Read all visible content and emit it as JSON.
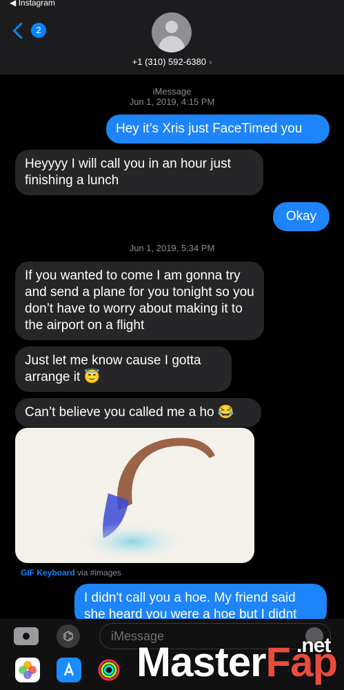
{
  "status": {
    "back_app": "◀ Instagram"
  },
  "header": {
    "unread_count": "2",
    "contact": "+1 (310) 592-6380",
    "contact_chevron": "›"
  },
  "thread": {
    "service": "iMessage",
    "timestamp1": "Jun 1, 2019, 4:15 PM",
    "timestamp2": "Jun 1, 2019, 5:34 PM",
    "messages": [
      {
        "dir": "out",
        "text": "Hey it’s Xris just FaceTimed you"
      },
      {
        "dir": "in",
        "text": "Heyyyy I will call you in an hour just finishing a lunch"
      },
      {
        "dir": "out",
        "text": "Okay"
      },
      {
        "dir": "in",
        "text": "If you wanted to come I am gonna try and send a plane for you tonight so you don’t have to worry about making it to the airport on a flight"
      },
      {
        "dir": "in",
        "text": "Just let me know cause I gotta arrange it 😇"
      },
      {
        "dir": "in",
        "text": "Can’t believe you called me a ho 😂"
      },
      {
        "dir": "out",
        "text": "I didn't call you a hoe. My friend said she heard you were a hoe but I didnt"
      }
    ],
    "gif_source": "GIF Keyboard",
    "gif_via": " via #images"
  },
  "composer": {
    "placeholder": "iMessage",
    "apps_icon": "⌬"
  },
  "watermark": {
    "main": "Master",
    "accent": "Fap",
    "tld": ".net"
  },
  "colors": {
    "incoming": "#262628",
    "outgoing": "#1e84fa",
    "accent": "#0a84ff"
  }
}
